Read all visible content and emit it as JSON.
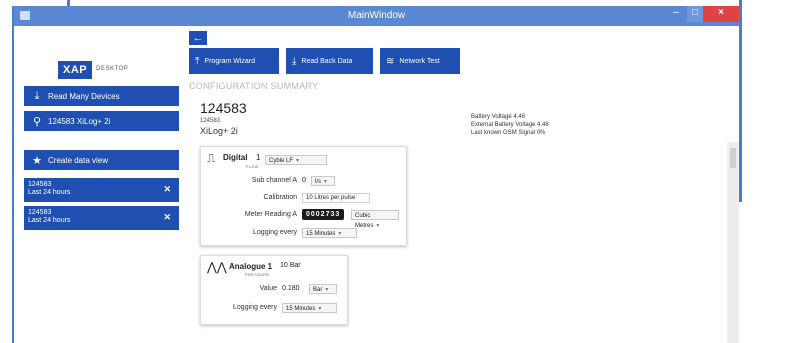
{
  "window": {
    "title": "MainWindow",
    "controls": [
      "–",
      "□",
      "×"
    ]
  },
  "sidebar": {
    "logo_text": "XAP",
    "logo_sub": "DESKTOP",
    "read_many_label": "Read Many Devices",
    "device_label": "124583 XiLog+ 2i",
    "create_view_label": "Create data view",
    "views": [
      {
        "serial": "124583",
        "period": "Last 24 hours"
      },
      {
        "serial": "124583",
        "period": "Last 24 hours"
      }
    ]
  },
  "toolbar": {
    "program_wizard": "Program Wizard",
    "read_back": "Read Back Data",
    "network_test": "Network Test"
  },
  "summary": {
    "title": "CONFIGURATION SUMMARY",
    "serial": "124583",
    "serial_small": "124583",
    "model": "XiLog+ 2i",
    "status": {
      "battery": "Battery Voltage 4.46",
      "ext_battery": "External Battery Voltage 4.48",
      "gsm": "Last known GSM Signal 0%"
    }
  },
  "digital": {
    "name": "Digital",
    "num": "1",
    "type": "FLOW",
    "sensor": "Cyble LF",
    "sub_channel_label": "Sub channel A",
    "sub_channel_value": "0",
    "sub_channel_unit": "l/s",
    "calibration_label": "Calibration",
    "calibration_value": "10 Litres per pulse",
    "meter_label": "Meter Reading A",
    "meter_value": "0002733",
    "meter_unit": "Cubic Metres",
    "logging_label": "Logging every",
    "logging_value": "15 Minutes"
  },
  "analogue": {
    "name": "Analogue 1",
    "range": "10 Bar",
    "type": "PRESSURE",
    "value_label": "Value",
    "value": "0.180",
    "unit": "Bar",
    "logging_label": "Logging every",
    "logging_value": "15 Minutes"
  }
}
